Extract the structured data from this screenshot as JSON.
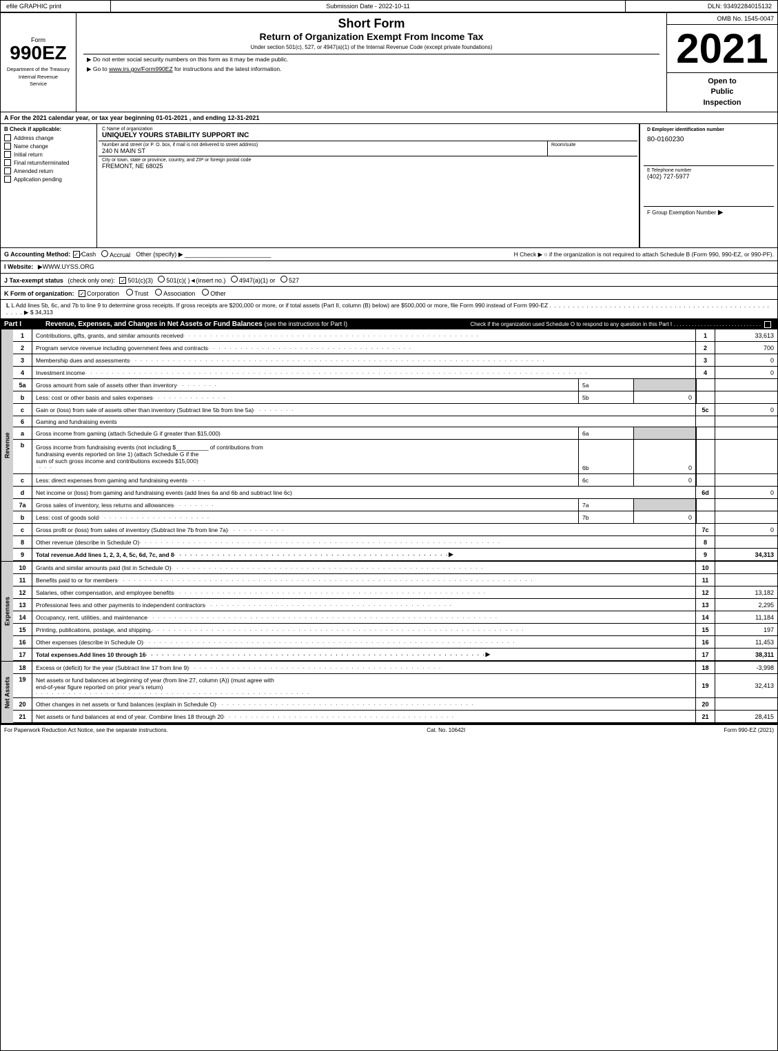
{
  "header": {
    "efile": "efile GRAPHIC print",
    "submission_label": "Submission Date - 2022-10-11",
    "dln": "DLN: 93492284015132"
  },
  "form": {
    "label": "Form",
    "number": "990EZ",
    "dept": "Department of the Treasury\nInternal Revenue Service",
    "title_main": "Short Form",
    "title_sub": "Return of Organization Exempt From Income Tax",
    "under_note": "Under section 501(c), 527, or 4947(a)(1) of the Internal Revenue Code (except private foundations)",
    "bullet1": "▶ Do not enter social security numbers on this form as it may be made public.",
    "bullet2": "▶ Go to www.irs.gov/Form990EZ for instructions and the latest information.",
    "omb": "OMB No. 1545-0047",
    "year": "2021",
    "open_to_public": "Open to\nPublic\nInspection"
  },
  "section_a": {
    "label": "A",
    "text": "For the 2021 calendar year, or tax year beginning 01-01-2021 , and ending 12-31-2021"
  },
  "section_b": {
    "label": "B Check if applicable:",
    "items": [
      {
        "id": "address-change",
        "label": "Address change",
        "checked": false
      },
      {
        "id": "name-change",
        "label": "Name change",
        "checked": false
      },
      {
        "id": "initial-return",
        "label": "Initial return",
        "checked": false
      },
      {
        "id": "final-return",
        "label": "Final return/terminated",
        "checked": false
      },
      {
        "id": "amended-return",
        "label": "Amended return",
        "checked": false
      },
      {
        "id": "application-pending",
        "label": "Application pending",
        "checked": false
      }
    ]
  },
  "org": {
    "name_label": "C Name of organization",
    "name": "UNIQUELY YOURS STABILITY SUPPORT INC",
    "address_label": "Number and street (or P. O. box, if mail is not delivered to street address)",
    "address": "240 N MAIN ST",
    "room_label": "Room/suite",
    "room": "",
    "city_label": "City or town, state or province, country, and ZIP or foreign postal code",
    "city": "FREMONT, NE  68025",
    "employer_label": "D Employer identification number",
    "ein": "80-0160230",
    "phone_label": "E Telephone number",
    "phone": "(402) 727-5977",
    "group_label": "F Group Exemption Number",
    "group_arrow": "▶"
  },
  "accounting": {
    "g_label": "G Accounting Method:",
    "cash": "✅ Cash",
    "accrual": "○ Accrual",
    "other": "Other (specify) ▶",
    "h_text": "H Check ▶  ○ if the organization is not required to attach Schedule B (Form 990, 990-EZ, or 990-PF)."
  },
  "website": {
    "i_label": "I Website:",
    "url": "▶WWW.UYSS.ORG"
  },
  "tax_exempt": {
    "j_label": "J Tax-exempt status",
    "note": "(check only one):",
    "options": "✅ 501(c)(3)  ○ 501(c)(    )◄(insert no.)  ○ 4947(a)(1) or  ○ 527"
  },
  "form_org": {
    "k_label": "K Form of organization:",
    "options": "✅ Corporation   ○ Trust   ○ Association   ○ Other"
  },
  "add_lines": {
    "l_text": "L Add lines 5b, 6c, and 7b to line 9 to determine gross receipts. If gross receipts are $200,000 or more, or if total assets (Part II, column (B) below) are $500,000 or more, file Form 990 instead of Form 990-EZ",
    "dots": ". . . . . . . . . . . . . . . . . . . . . . . . . . . . . . . . . . . . . . . . . .",
    "arrow": "▶",
    "value": "$ 34,313"
  },
  "part1": {
    "number": "Part I",
    "title": "Revenue, Expenses, and Changes in Net Assets or Fund Balances",
    "see_instructions": "(see the instructions for Part I)",
    "check_note": "Check if the organization used Schedule O to respond to any question in this Part I",
    "rows": [
      {
        "num": "1",
        "desc": "Contributions, gifts, grants, and similar amounts received",
        "dots": ". . . . . . . . . . . . . . . . . . . . . . . . . . . . . . . . . . . . . . . . . . . . . . . . . . . . . . . . . . . . . . . . . . . .",
        "line": "1",
        "value": "33,613"
      },
      {
        "num": "2",
        "desc": "Program service revenue including government fees and contracts",
        "dots": ". . . . . . . . . . . . . . . . . . . . . . . . . . . . . . . . . . . . . . . . . . .",
        "line": "2",
        "value": "700"
      },
      {
        "num": "3",
        "desc": "Membership dues and assessments",
        "dots": ". . . . . . . . . . . . . . . . . . . . . . . . . . . . . . . . . . . . . . . . . . . . . . . . . . . . . . . . . . . . . . . . . . . . . . . . . . . . .",
        "line": "3",
        "value": "0"
      },
      {
        "num": "4",
        "desc": "Investment income",
        "dots": ". . . . . . . . . . . . . . . . . . . . . . . . . . . . . . . . . . . . . . . . . . . . . . . . . . . . . . . . . . . . . . . . . . . . . . . . . . . . . . . . . . . . . . . . . . . . . .",
        "line": "4",
        "value": "0"
      },
      {
        "num": "5a",
        "desc": "Gross amount from sale of assets other than inventory",
        "sub_label": "5a",
        "sub_value": ""
      },
      {
        "num": "b",
        "desc": "Less: cost or other basis and sales expenses",
        "sub_label": "5b",
        "sub_value": "0"
      },
      {
        "num": "c",
        "desc": "Gain or (loss) from sale of assets other than inventory (Subtract line 5b from line 5a)",
        "dots": ". . . . . . . .",
        "line": "5c",
        "value": "0"
      },
      {
        "num": "6",
        "desc": "Gaming and fundraising events",
        "dots": "",
        "line": "",
        "value": ""
      },
      {
        "num": "a",
        "desc": "Gross income from gaming (attach Schedule G if greater than $15,000)",
        "sub_label": "6a",
        "sub_value": ""
      },
      {
        "num": "b",
        "desc": "Gross income from fundraising events (not including $__________ of contributions from fundraising events reported on line 1) (attach Schedule G if the sum of such gross income and contributions exceeds $15,000)",
        "dots2": ". . .",
        "sub_label": "6b",
        "sub_value": "0"
      },
      {
        "num": "c",
        "desc": "Less: direct expenses from gaming and fundraising events",
        "dots2": ". . . .",
        "sub_label": "6c",
        "sub_value": "0"
      },
      {
        "num": "d",
        "desc": "Net income or (loss) from gaming and fundraising events (add lines 6a and 6b and subtract line 6c)",
        "line": "6d",
        "value": "0"
      },
      {
        "num": "7a",
        "desc": "Gross sales of inventory, less returns and allowances",
        "sub_label": "7a",
        "sub_value": ""
      },
      {
        "num": "b",
        "desc": "Less: cost of goods sold",
        "dots2": ". . . . . . . . . . . . . . . . . . . . .",
        "sub_label": "7b",
        "sub_value": "0"
      },
      {
        "num": "c",
        "desc": "Gross profit or (loss) from sales of inventory (Subtract line 7b from line 7a)",
        "dots": ". . . . . . . . . . .",
        "line": "7c",
        "value": "0"
      },
      {
        "num": "8",
        "desc": "Other revenue (describe in Schedule O)",
        "dots": ". . . . . . . . . . . . . . . . . . . . . . . . . . . . . . . . . . . . . . . . . . . . . . . . . . . . . . . . . . . . . . . . . . . .",
        "line": "8",
        "value": ""
      },
      {
        "num": "9",
        "desc": "Total revenue. Add lines 1, 2, 3, 4, 5c, 6d, 7c, and 8",
        "dots": ". . . . . . . . . . . . . . . . . . . . . . . . . . . . . . . . . . . . . . . . . . . . . . . . . . . . . . . . .",
        "arrow": "▶",
        "line": "9",
        "value": "34,313",
        "bold": true
      }
    ]
  },
  "expenses": {
    "rows": [
      {
        "num": "10",
        "desc": "Grants and similar amounts paid (list in Schedule O)",
        "dots": ". . . . . . . . . . . . . . . . . . . . . . . . . . . . . . . . . . . . . . . . . . . . . . . . . . . . . . . . . . . . . .",
        "line": "10",
        "value": ""
      },
      {
        "num": "11",
        "desc": "Benefits paid to or for members",
        "dots": ". . . . . . . . . . . . . . . . . . . . . . . . . . . . . . . . . . . . . . . . . . . . . . . . . . . . . . . . . . . . . . . . . . . . . . . . . . . . . . .",
        "line": "11",
        "value": ""
      },
      {
        "num": "12",
        "desc": "Salaries, other compensation, and employee benefits",
        "dots": ". . . . . . . . . . . . . . . . . . . . . . . . . . . . . . . . . . . . . . . . . . . . . . . . . . . . . . . . . . . . . .",
        "line": "12",
        "value": "13,182"
      },
      {
        "num": "13",
        "desc": "Professional fees and other payments to independent contractors",
        "dots": ". . . . . . . . . . . . . . . . . . . . . . . . . . . . . . . . . . . . . . . . . . . . . . .",
        "line": "13",
        "value": "2,295"
      },
      {
        "num": "14",
        "desc": "Occupancy, rent, utilities, and maintenance",
        "dots": ". . . . . . . . . . . . . . . . . . . . . . . . . . . . . . . . . . . . . . . . . . . . . . . . . . . . . . . . . . . . . . . . . . . . . . .",
        "line": "14",
        "value": "11,184"
      },
      {
        "num": "15",
        "desc": "Printing, publications, postage, and shipping.",
        "dots": ". . . . . . . . . . . . . . . . . . . . . . . . . . . . . . . . . . . . . . . . . . . . . . . . . . . . . . . . . . . . . . . . . . . .",
        "line": "15",
        "value": "197"
      },
      {
        "num": "16",
        "desc": "Other expenses (describe in Schedule O)",
        "dots": ". . . . . . . . . . . . . . . . . . . . . . . . . . . . . . . . . . . . . . . . . . . . . . . . . . . . . . . . . . . . . . . . . . . . .",
        "line": "16",
        "value": "11,453"
      },
      {
        "num": "17",
        "desc": "Total expenses. Add lines 10 through 16",
        "dots": ". . . . . . . . . . . . . . . . . . . . . . . . . . . . . . . . . . . . . . . . . . . . . . . . . . . . . . . . . . . . . . .",
        "arrow": "▶",
        "line": "17",
        "value": "38,311",
        "bold": true
      }
    ]
  },
  "net_assets": {
    "rows": [
      {
        "num": "18",
        "desc": "Excess or (deficit) for the year (Subtract line 17 from line 9)",
        "dots": ". . . . . . . . . . . . . . . . . . . . . . . . . . . . . . . . . . . . . . . . . . . . . .",
        "line": "18",
        "value": "-3,998"
      },
      {
        "num": "19",
        "desc": "Net assets or fund balances at beginning of year (from line 27, column (A)) (must agree with end-of-year figure reported on prior year's return)",
        "dots": ". . . . . . . . . . . . . . . . . . . . . . . . . . . . . . . . . . . . . . . . . . . . . . . . . . . . .",
        "line": "19",
        "value": "32,413"
      },
      {
        "num": "20",
        "desc": "Other changes in net assets or fund balances (explain in Schedule O)",
        "dots": ". . . . . . . . . . . . . . . . . . . . . . . . . . . . . . . . . . . . . . . . . . . . . . . . . . . .",
        "line": "20",
        "value": ""
      },
      {
        "num": "21",
        "desc": "Net assets or fund balances at end of year. Combine lines 18 through 20",
        "dots": ". . . . . . . . . . . . . . . . . . . . . . . . . . . . . . . . . . . . . . . . . . . . .",
        "line": "21",
        "value": "28,415"
      }
    ]
  },
  "footer": {
    "paperwork": "For Paperwork Reduction Act Notice, see the separate instructions.",
    "cat_no": "Cat. No. 10642I",
    "form_ref": "Form 990-EZ (2021)"
  }
}
